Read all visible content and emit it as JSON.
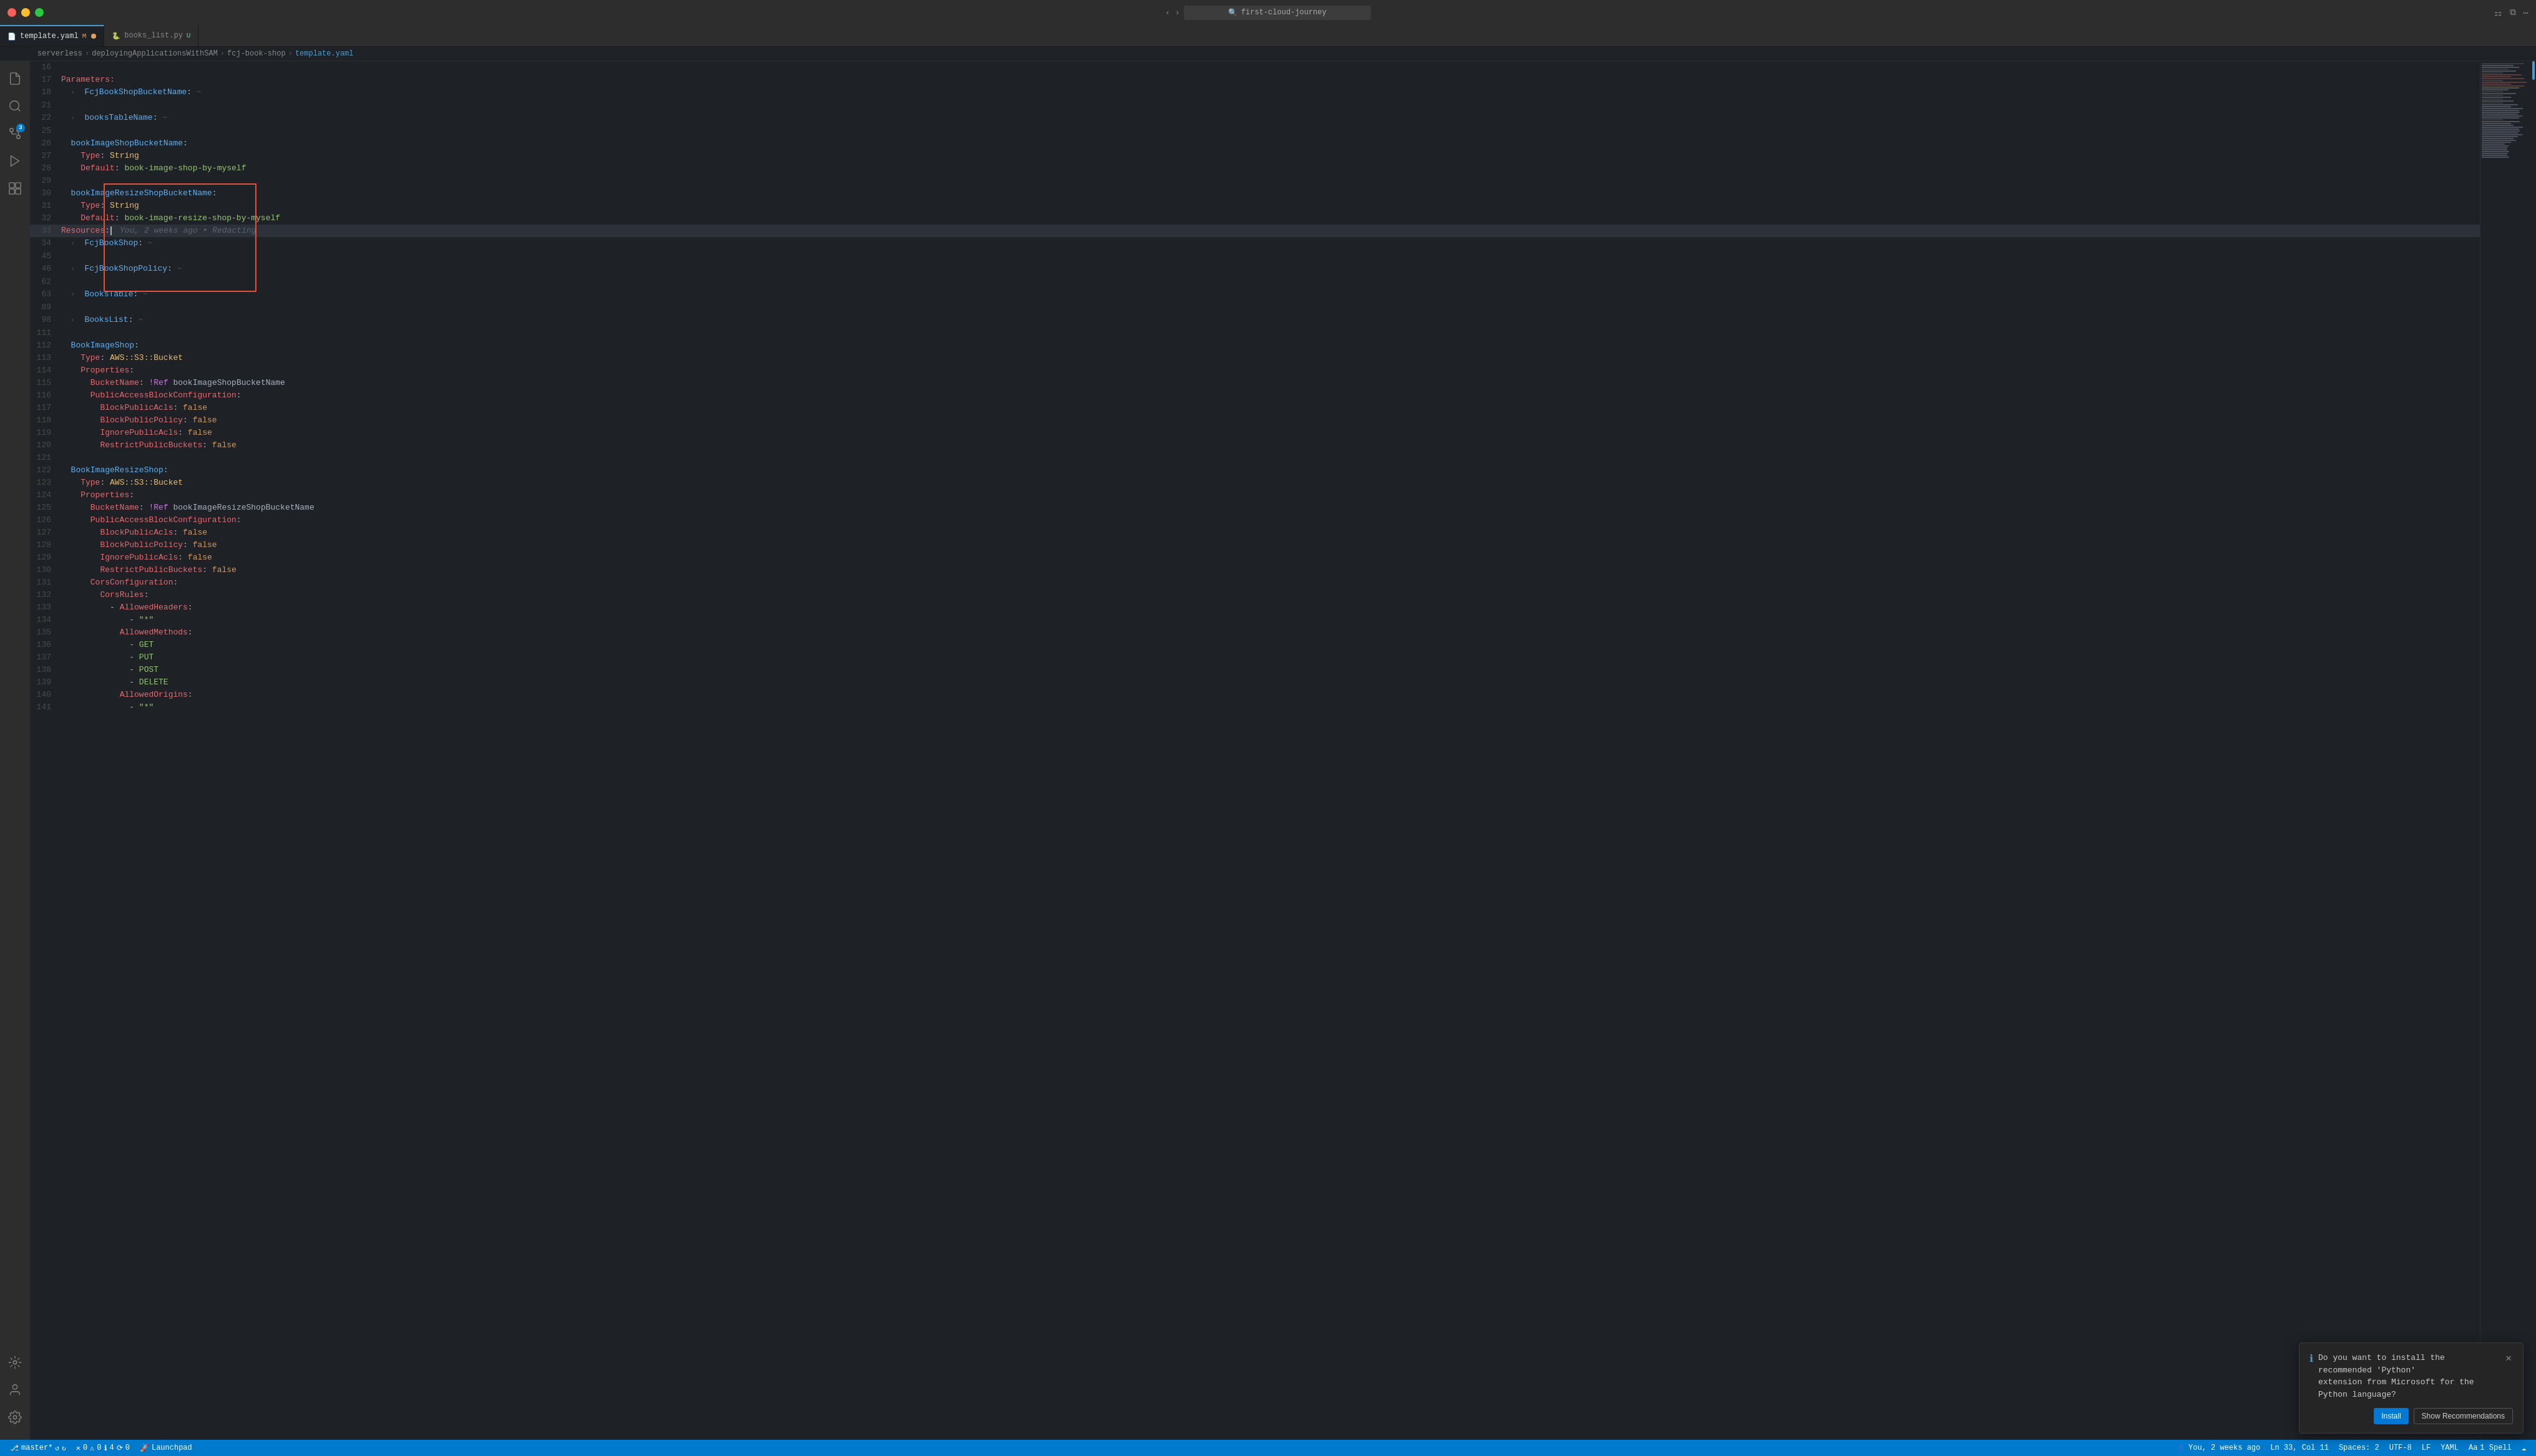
{
  "window": {
    "title": "first-cloud-journey",
    "search_placeholder": "first-cloud-journey"
  },
  "tabs": [
    {
      "id": "template-yaml",
      "label": "template.yaml",
      "git": "M",
      "active": true,
      "icon": "yaml",
      "dot": true
    },
    {
      "id": "books-list-py",
      "label": "books_list.py",
      "git": "U",
      "active": false,
      "icon": "python",
      "dot": false
    }
  ],
  "breadcrumb": {
    "parts": [
      "serverless",
      "deployingApplicationsWithSAM",
      "fcj-book-shop",
      "template.yaml"
    ]
  },
  "code_lines": [
    {
      "num": 16,
      "content": ""
    },
    {
      "num": 17,
      "indent": 0,
      "content": "Parameters:"
    },
    {
      "num": 18,
      "indent": 1,
      "content": "  FcjBookShopBucketName: ~",
      "collapsed": true
    },
    {
      "num": 21,
      "content": ""
    },
    {
      "num": 22,
      "indent": 1,
      "content": "  booksTableName: ~",
      "collapsed": true
    },
    {
      "num": 25,
      "content": ""
    },
    {
      "num": 26,
      "indent": 1,
      "content": "  bookImageShopBucketName:",
      "highlight_start": true
    },
    {
      "num": 27,
      "indent": 2,
      "content": "    Type: String"
    },
    {
      "num": 28,
      "indent": 2,
      "content": "    Default: book-image-shop-by-myself"
    },
    {
      "num": 29,
      "content": ""
    },
    {
      "num": 30,
      "indent": 1,
      "content": "  bookImageResizeShopBucketName:"
    },
    {
      "num": 31,
      "indent": 2,
      "content": "    Type: String"
    },
    {
      "num": 32,
      "indent": 2,
      "content": "    Default: book-image-resize-shop-by-myself",
      "highlight_end": true
    },
    {
      "num": 33,
      "indent": 0,
      "content": "Resources:",
      "cursor": true,
      "tooltip": "You, 2 weeks ago • Redacting"
    },
    {
      "num": 34,
      "indent": 1,
      "content": "  FcjBookShop: ~",
      "collapsed": true
    },
    {
      "num": 45,
      "content": ""
    },
    {
      "num": 46,
      "indent": 1,
      "content": "  FcjBookShopPolicy: ~",
      "collapsed": true
    },
    {
      "num": 62,
      "content": ""
    },
    {
      "num": 63,
      "indent": 1,
      "content": "  BooksTable: ~",
      "collapsed": true
    },
    {
      "num": 89,
      "content": ""
    },
    {
      "num": 98,
      "indent": 1,
      "content": "  BooksList: ~",
      "collapsed": true
    },
    {
      "num": 111,
      "content": ""
    },
    {
      "num": 112,
      "indent": 1,
      "content": "  BookImageShop:"
    },
    {
      "num": 113,
      "indent": 2,
      "content": "    Type: AWS::S3::Bucket"
    },
    {
      "num": 114,
      "indent": 2,
      "content": "    Properties:"
    },
    {
      "num": 115,
      "indent": 3,
      "content": "      BucketName: !Ref bookImageShopBucketName"
    },
    {
      "num": 116,
      "indent": 3,
      "content": "      PublicAccessBlockConfiguration:"
    },
    {
      "num": 117,
      "indent": 4,
      "content": "        BlockPublicAcls: false"
    },
    {
      "num": 118,
      "indent": 4,
      "content": "        BlockPublicPolicy: false"
    },
    {
      "num": 119,
      "indent": 4,
      "content": "        IgnorePublicAcls: false"
    },
    {
      "num": 120,
      "indent": 4,
      "content": "        RestrictPublicBuckets: false"
    },
    {
      "num": 121,
      "content": ""
    },
    {
      "num": 122,
      "indent": 1,
      "content": "  BookImageResizeShop:"
    },
    {
      "num": 123,
      "indent": 2,
      "content": "    Type: AWS::S3::Bucket"
    },
    {
      "num": 124,
      "indent": 2,
      "content": "    Properties:"
    },
    {
      "num": 125,
      "indent": 3,
      "content": "      BucketName: !Ref bookImageResizeShopBucketName"
    },
    {
      "num": 126,
      "indent": 3,
      "content": "      PublicAccessBlockConfiguration:"
    },
    {
      "num": 127,
      "indent": 4,
      "content": "        BlockPublicAcls: false"
    },
    {
      "num": 128,
      "indent": 4,
      "content": "        BlockPublicPolicy: false"
    },
    {
      "num": 129,
      "indent": 4,
      "content": "        IgnorePublicAcls: false"
    },
    {
      "num": 130,
      "indent": 4,
      "content": "        RestrictPublicBuckets: false"
    },
    {
      "num": 131,
      "indent": 3,
      "content": "      CorsConfiguration:"
    },
    {
      "num": 132,
      "indent": 4,
      "content": "        CorsRules:"
    },
    {
      "num": 133,
      "indent": 5,
      "content": "          - AllowedHeaders:"
    },
    {
      "num": 134,
      "indent": 6,
      "content": "              - \"*\""
    },
    {
      "num": 135,
      "indent": 5,
      "content": "            AllowedMethods:"
    },
    {
      "num": 136,
      "indent": 6,
      "content": "              - GET"
    },
    {
      "num": 137,
      "indent": 6,
      "content": "              - PUT"
    },
    {
      "num": 138,
      "indent": 6,
      "content": "              - POST"
    },
    {
      "num": 139,
      "indent": 6,
      "content": "              - DELETE"
    },
    {
      "num": 140,
      "indent": 5,
      "content": "            AllowedOrigins:"
    },
    {
      "num": 141,
      "indent": 6,
      "content": "              - \"*\""
    }
  ],
  "notification": {
    "title": "Do you want to install the recommended 'Python'",
    "subtitle": "extension from Microsoft for the Python language?",
    "install_label": "Install",
    "recommendations_label": "Show Recommendations"
  },
  "status_bar": {
    "branch": "master*",
    "errors": "0",
    "warnings": "0",
    "info": "4",
    "port": "0",
    "launchpad": "Launchpad",
    "user": "You, 2 weeks ago",
    "position": "Ln 33, Col 11",
    "spaces": "Spaces: 2",
    "encoding": "UTF-8",
    "eol": "LF",
    "language": "YAML",
    "spell": "1 Spell"
  },
  "activity_bar": {
    "icons": [
      {
        "id": "explorer",
        "symbol": "⎇",
        "badge": null
      },
      {
        "id": "search",
        "symbol": "🔍",
        "badge": null
      },
      {
        "id": "source-control",
        "symbol": "⑃",
        "badge": "3"
      },
      {
        "id": "run-debug",
        "symbol": "▷",
        "badge": null
      },
      {
        "id": "extensions",
        "symbol": "⊞",
        "badge": null
      },
      {
        "id": "remote",
        "symbol": "◫",
        "badge": null
      },
      {
        "id": "copilot",
        "symbol": "✦",
        "badge": null
      }
    ]
  }
}
